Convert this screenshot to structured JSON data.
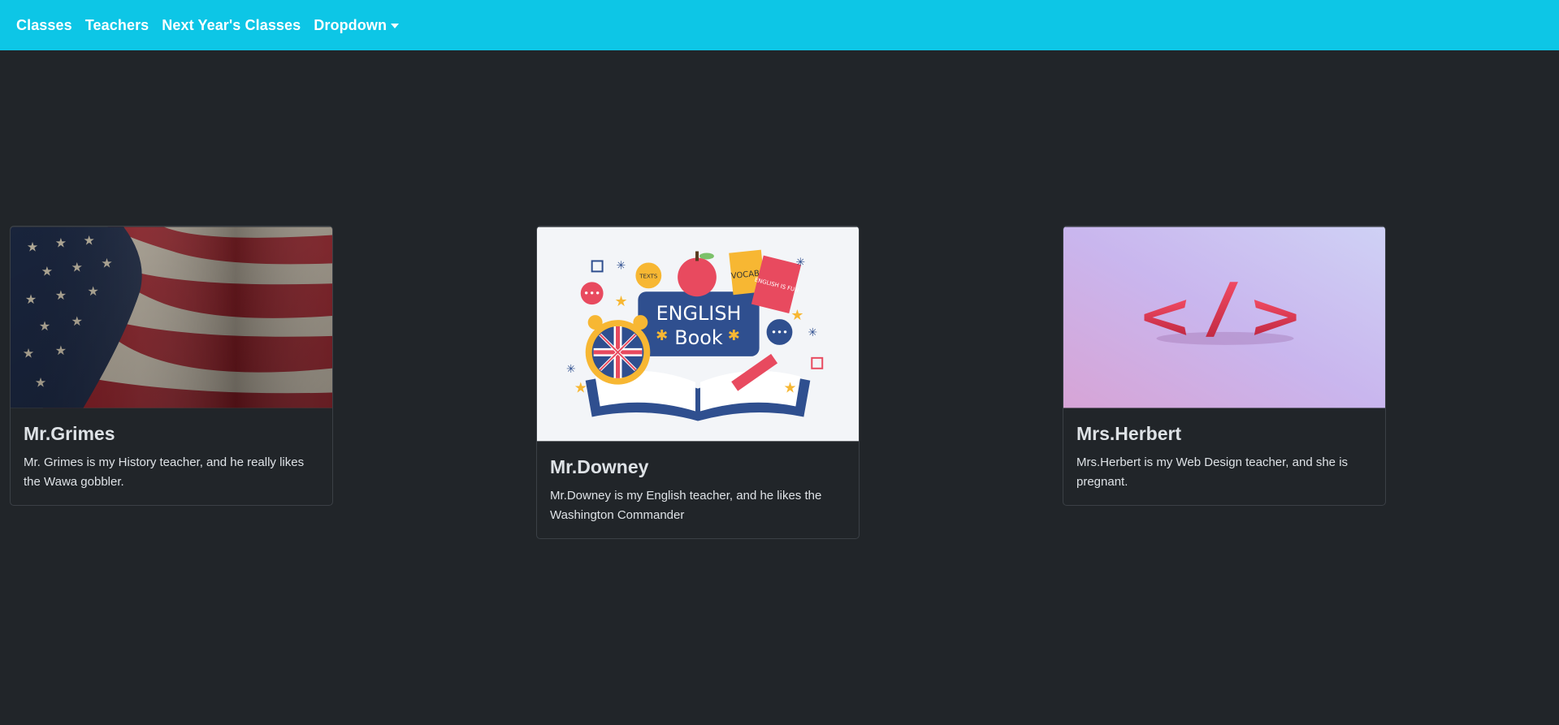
{
  "navbar": {
    "items": [
      {
        "label": "Classes"
      },
      {
        "label": "Teachers"
      },
      {
        "label": "Next Year's Classes"
      },
      {
        "label": "Dropdown"
      }
    ]
  },
  "cards": [
    {
      "title": "Mr.Grimes",
      "text": "Mr. Grimes is my History teacher, and he really likes the Wawa gobbler.",
      "image": "american-flag-image"
    },
    {
      "title": "Mr.Downey",
      "text": "Mr.Downey is my English teacher, and he likes the Washington Commander",
      "image": "english-book-illustration",
      "image_text": [
        "ENGLISH",
        "Book",
        "VOCAB",
        "ENGLISH IS FUN",
        "TEXTS"
      ]
    },
    {
      "title": "Mrs.Herbert",
      "text": "Mrs.Herbert is my Web Design teacher, and she is pregnant.",
      "image": "code-tag-image"
    }
  ],
  "colors": {
    "navbar_bg": "#0dc6e6",
    "page_bg": "#212529",
    "text": "#dee2e6"
  }
}
